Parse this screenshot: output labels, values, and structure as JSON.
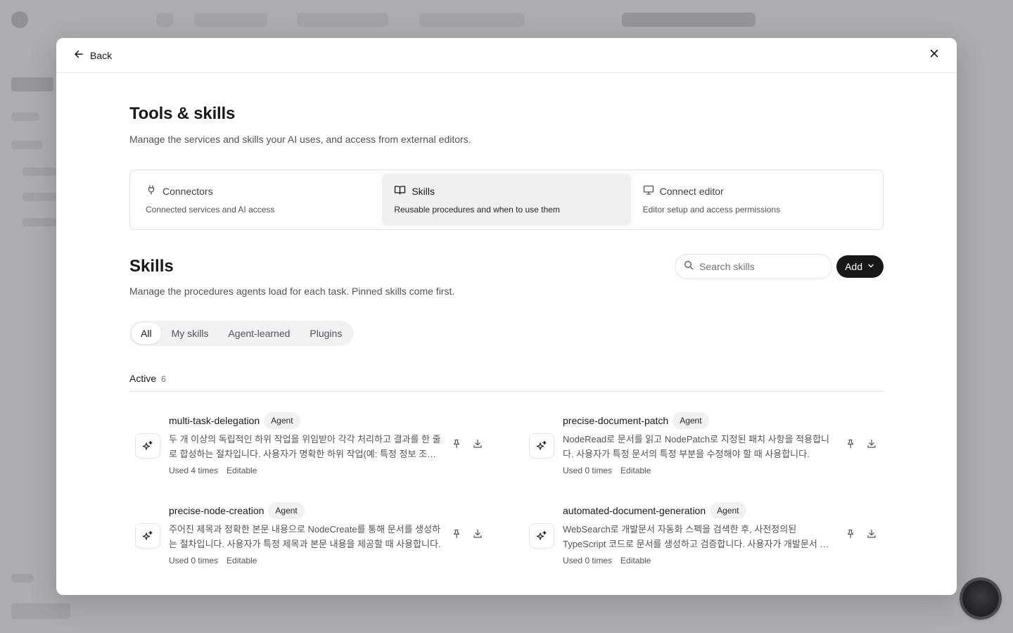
{
  "modal": {
    "back_label": "Back",
    "title": "Tools & skills",
    "description": "Manage the services and skills your AI uses, and access from external editors."
  },
  "section_tabs": [
    {
      "label": "Connectors",
      "sub": "Connected services and AI access",
      "icon": "plug-icon"
    },
    {
      "label": "Skills",
      "sub": "Reusable procedures and when to use them",
      "icon": "book-icon"
    },
    {
      "label": "Connect editor",
      "sub": "Editor setup and access permissions",
      "icon": "monitor-icon"
    }
  ],
  "skills": {
    "title": "Skills",
    "description": "Manage the procedures agents load for each task. Pinned skills come first.",
    "search_placeholder": "Search skills",
    "add_label": "Add",
    "filters": [
      "All",
      "My skills",
      "Agent-learned",
      "Plugins"
    ],
    "active_filter": "All",
    "section_label": "Active",
    "section_count": "6",
    "items": [
      {
        "name": "multi-task-delegation",
        "badge": "Agent",
        "description": "두 개 이상의 독립적인 하위 작업을 위임받아 각각 처리하고 결과를 한 줄로 합성하는 절차입니다. 사용자가 명확한 하위 작업(예: 특정 정보 조회)을 제공...",
        "used": "Used 4 times",
        "status": "Editable"
      },
      {
        "name": "precise-document-patch",
        "badge": "Agent",
        "description": "NodeRead로 문서를 읽고 NodePatch로 지정된 패치 사항을 적용합니다. 사용자가 특정 문서의 특정 부분을 수정해야 할 때 사용합니다.",
        "used": "Used 0 times",
        "status": "Editable"
      },
      {
        "name": "precise-node-creation",
        "badge": "Agent",
        "description": "주어진 제목과 정확한 본문 내용으로 NodeCreate를 통해 문서를 생성하는 절차입니다. 사용자가 특정 제목과 본문 내용을 제공할 때 사용합니다.",
        "used": "Used 0 times",
        "status": "Editable"
      },
      {
        "name": "automated-document-generation",
        "badge": "Agent",
        "description": "WebSearch로 개발문서 자동화 스펙을 검색한 후, 사전정의된 TypeScript 코드로 문서를 생성하고 검증합니다. 사용자가 개발문서 자동화 스펙을 확인...",
        "used": "Used 0 times",
        "status": "Editable"
      }
    ]
  },
  "colors": {
    "accent": "#18181b",
    "active_tab_bg": "#efeff1",
    "badge_bg": "#f1f1f3"
  }
}
